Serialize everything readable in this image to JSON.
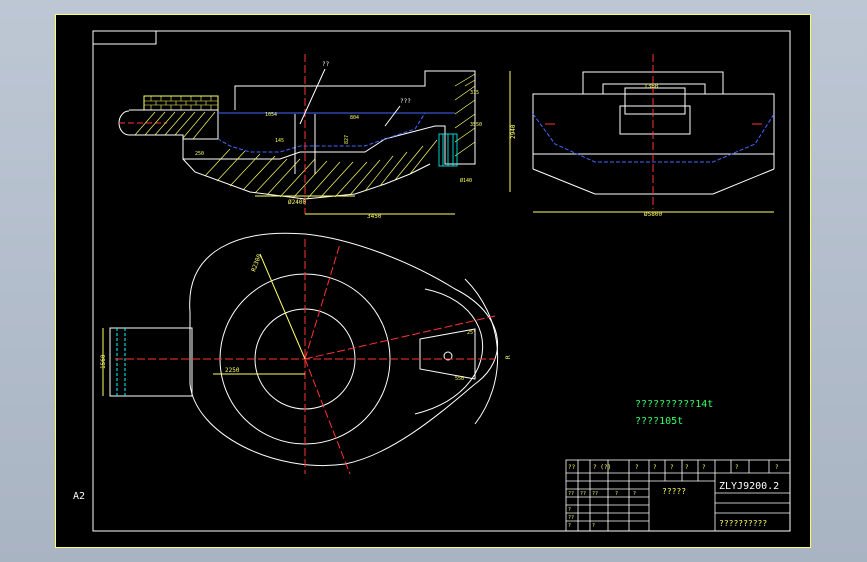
{
  "sheet": {
    "size_label": "A2"
  },
  "section_view": {
    "leader_label": "??",
    "top_label": "???",
    "dimensions": {
      "dia_2400": "Ø2400",
      "length_3450": "3450",
      "height_2940": "2940",
      "dia_140": "Ø140",
      "d1": "1054",
      "d2": "804",
      "d3": "145",
      "d4": "250",
      "d5": "315",
      "d6": "827",
      "d7": "3550"
    }
  },
  "side_view": {
    "dimensions": {
      "width_1360": "1360",
      "dia_5800": "Ø5800"
    }
  },
  "plan_view": {
    "dimensions": {
      "d_1560": "1560",
      "r_2300": "R2300",
      "d_2250": "2250",
      "d_550": "550",
      "d_ang": "25°",
      "d_r": "R"
    }
  },
  "notes": {
    "line1": "??????????14t",
    "line2": "????105t"
  },
  "title_block": {
    "drawing_no": "ZLYJ9200.2",
    "part_name": "?????",
    "company": "??????????",
    "header_cells": [
      "??",
      "? (?)",
      "?",
      "?",
      "?",
      "?",
      "?",
      "?",
      "?"
    ],
    "small_cells": [
      "??",
      "??",
      "??",
      "?",
      "?",
      "?",
      "??",
      "?",
      "?"
    ]
  }
}
